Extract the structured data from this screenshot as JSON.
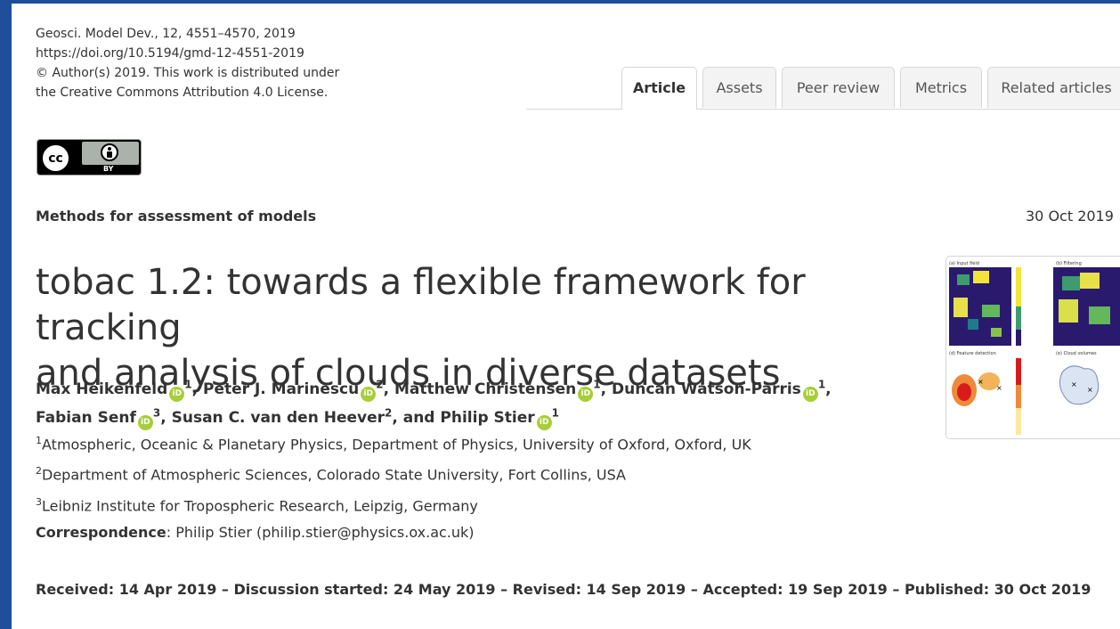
{
  "citation": {
    "line1": "Geosci. Model Dev., 12, 4551–4570, 2019",
    "line2": "https://doi.org/10.5194/gmd-12-4551-2019",
    "line3": "© Author(s) 2019. This work is distributed under",
    "line4": "the Creative Commons Attribution 4.0 License."
  },
  "license_badge": {
    "cc": "cc",
    "by": "BY"
  },
  "tabs": [
    {
      "label": "Article",
      "active": true
    },
    {
      "label": "Assets"
    },
    {
      "label": "Peer review"
    },
    {
      "label": "Metrics"
    },
    {
      "label": "Related articles"
    }
  ],
  "section": "Methods for assessment of models",
  "date": "30 Oct 2019",
  "title_line1": "tobac 1.2: towards a flexible framework for tracking",
  "title_line2": "and analysis of clouds in diverse datasets",
  "orcid_icon": "orcid-icon",
  "authors": [
    {
      "name": "Max Heikenfeld",
      "aff": "1"
    },
    {
      "name": "Peter J. Marinescu",
      "aff": "2"
    },
    {
      "name": "Matthew Christensen",
      "aff": "1"
    },
    {
      "name": "Duncan Watson-Parris",
      "aff": "1"
    },
    {
      "name": "Fabian Senf",
      "aff": "3"
    },
    {
      "name": "Susan C. van den Heever",
      "aff": "2"
    },
    {
      "name": "Philip Stier",
      "aff": "1"
    }
  ],
  "affiliations": [
    {
      "num": "1",
      "text": "Atmospheric, Oceanic & Planetary Physics, Department of Physics, University of Oxford, Oxford, UK"
    },
    {
      "num": "2",
      "text": "Department of Atmospheric Sciences, Colorado State University, Fort Collins, USA"
    },
    {
      "num": "3",
      "text": "Leibniz Institute for Tropospheric Research, Leipzig, Germany"
    }
  ],
  "correspondence": {
    "label": "Correspondence",
    "text": ": Philip Stier (philip.stier@physics.ox.ac.uk)"
  },
  "history": "Received: 14 Apr 2019 – Discussion started: 24 May 2019 – Revised: 14 Sep 2019 – Accepted: 19 Sep 2019 – Published: 30 Oct 2019",
  "thumbnail": {
    "panel_a": "(a) Input field",
    "panel_b": "(b) Filtering",
    "panel_d": "(d) Feature detection",
    "panel_e": "(e) Cloud volumes"
  },
  "colors": {
    "frame": "#1f4e9a",
    "orcid": "#a6ce39"
  }
}
